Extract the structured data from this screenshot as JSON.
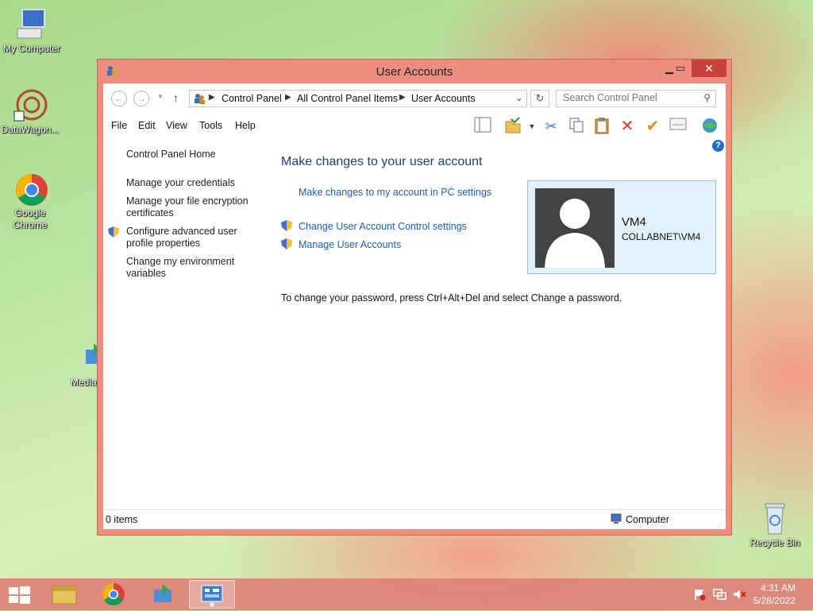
{
  "desktop": {
    "icons": [
      {
        "label": "My Computer",
        "icon": "computer-icon"
      },
      {
        "label": "DataWagon...",
        "icon": "datawagon-icon"
      },
      {
        "label": "Google Chrome",
        "icon": "chrome-icon"
      },
      {
        "label": "MediaG",
        "icon": "media-icon"
      },
      {
        "label": "Recycle Bin",
        "icon": "recycle-bin-icon"
      }
    ]
  },
  "window": {
    "title": "User Accounts",
    "breadcrumb": [
      "Control Panel",
      "All Control Panel Items",
      "User Accounts"
    ],
    "search_placeholder": "Search Control Panel",
    "menu": [
      "File",
      "Edit",
      "View",
      "Tools",
      "Help"
    ],
    "toolbar_icons": [
      "layout-icon",
      "folder-options-icon",
      "dropdown-icon",
      "cut-icon",
      "copy-icon",
      "paste-icon",
      "delete-icon",
      "checkmark-icon",
      "properties-icon",
      "globe-icon"
    ],
    "left_links": [
      "Control Panel Home",
      "Manage your credentials",
      "Manage your file encryption certificates",
      "Configure advanced user profile properties",
      "Change my environment variables"
    ],
    "main": {
      "title": "Make changes to your user account",
      "link_pc_settings": "Make changes to my account in PC settings",
      "link_uac": "Change User Account Control settings",
      "link_manage": "Manage User Accounts",
      "password_note": "To change your password, press Ctrl+Alt+Del and select Change a password."
    },
    "user": {
      "name": "VM4",
      "domain": "COLLABNET\\VM4"
    },
    "status": {
      "items": "0 items",
      "location": "Computer"
    }
  },
  "taskbar": {
    "items": [
      "start-icon",
      "file-explorer-icon",
      "chrome-icon",
      "media-icon",
      "control-panel-icon"
    ],
    "tray_icons": [
      "flag-icon",
      "network-icon",
      "volume-muted-icon"
    ],
    "time": "4:31 AM",
    "date": "5/28/2022"
  },
  "colors": {
    "window_frame": "#ec8d80",
    "close_button": "#c7403a",
    "link": "#1a5fb4",
    "heading": "#1e3f82"
  }
}
